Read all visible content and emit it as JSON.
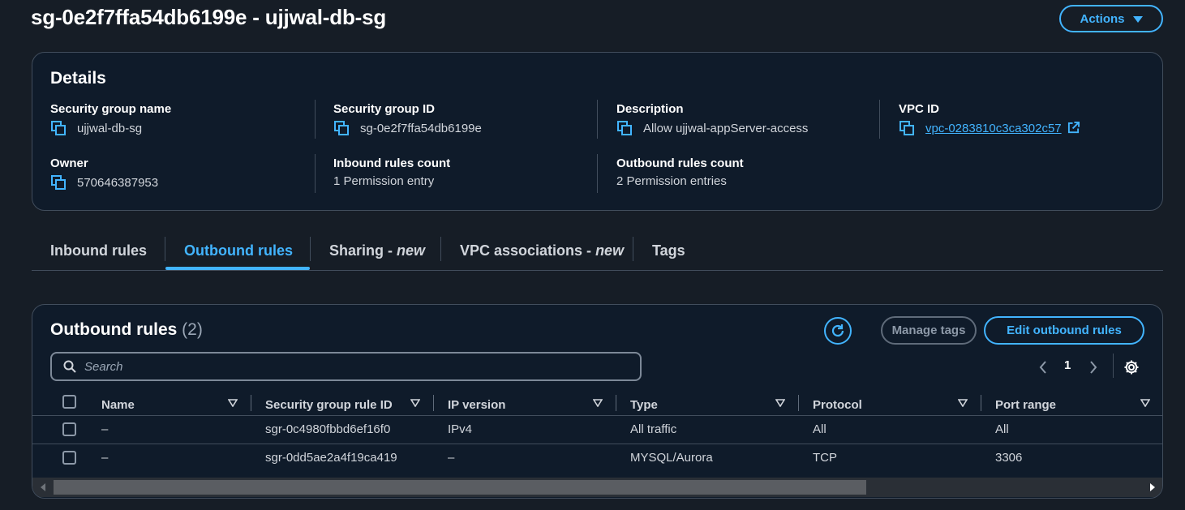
{
  "page": {
    "title": "sg-0e2f7ffa54db6199e - ujjwal-db-sg",
    "actions_label": "Actions"
  },
  "details": {
    "heading": "Details",
    "fields": {
      "sg_name": {
        "label": "Security group name",
        "value": "ujjwal-db-sg"
      },
      "sg_id": {
        "label": "Security group ID",
        "value": "sg-0e2f7ffa54db6199e"
      },
      "description": {
        "label": "Description",
        "value": "Allow ujjwal-appServer-access"
      },
      "vpc_id": {
        "label": "VPC ID",
        "value": "vpc-0283810c3ca302c57"
      },
      "owner": {
        "label": "Owner",
        "value": "570646387953"
      },
      "inbound_count": {
        "label": "Inbound rules count",
        "value": "1 Permission entry"
      },
      "outbound_count": {
        "label": "Outbound rules count",
        "value": "2 Permission entries"
      }
    }
  },
  "tabs": [
    {
      "label": "Inbound rules",
      "suffix": "",
      "active": false
    },
    {
      "label": "Outbound rules",
      "suffix": "",
      "active": true
    },
    {
      "label": "Sharing -",
      "suffix": "new",
      "active": false
    },
    {
      "label": "VPC associations -",
      "suffix": "new",
      "active": false
    },
    {
      "label": "Tags",
      "suffix": "",
      "active": false
    }
  ],
  "rules": {
    "heading": "Outbound rules",
    "count": "(2)",
    "manage_tags_label": "Manage tags",
    "edit_label": "Edit outbound rules",
    "search_placeholder": "Search",
    "page_number": "1",
    "columns": [
      "Name",
      "Security group rule ID",
      "IP version",
      "Type",
      "Protocol",
      "Port range"
    ],
    "rows": [
      {
        "name": "–",
        "rule_id": "sgr-0c4980fbbd6ef16f0",
        "ip_version": "IPv4",
        "type": "All traffic",
        "protocol": "All",
        "port_range": "All"
      },
      {
        "name": "–",
        "rule_id": "sgr-0dd5ae2a4f19ca419",
        "ip_version": "–",
        "type": "MYSQL/Aurora",
        "protocol": "TCP",
        "port_range": "3306"
      }
    ]
  },
  "colors": {
    "background": "#161d26",
    "panel": "#0f1b2a",
    "accent": "#42b4ff",
    "border": "#414d5c"
  }
}
